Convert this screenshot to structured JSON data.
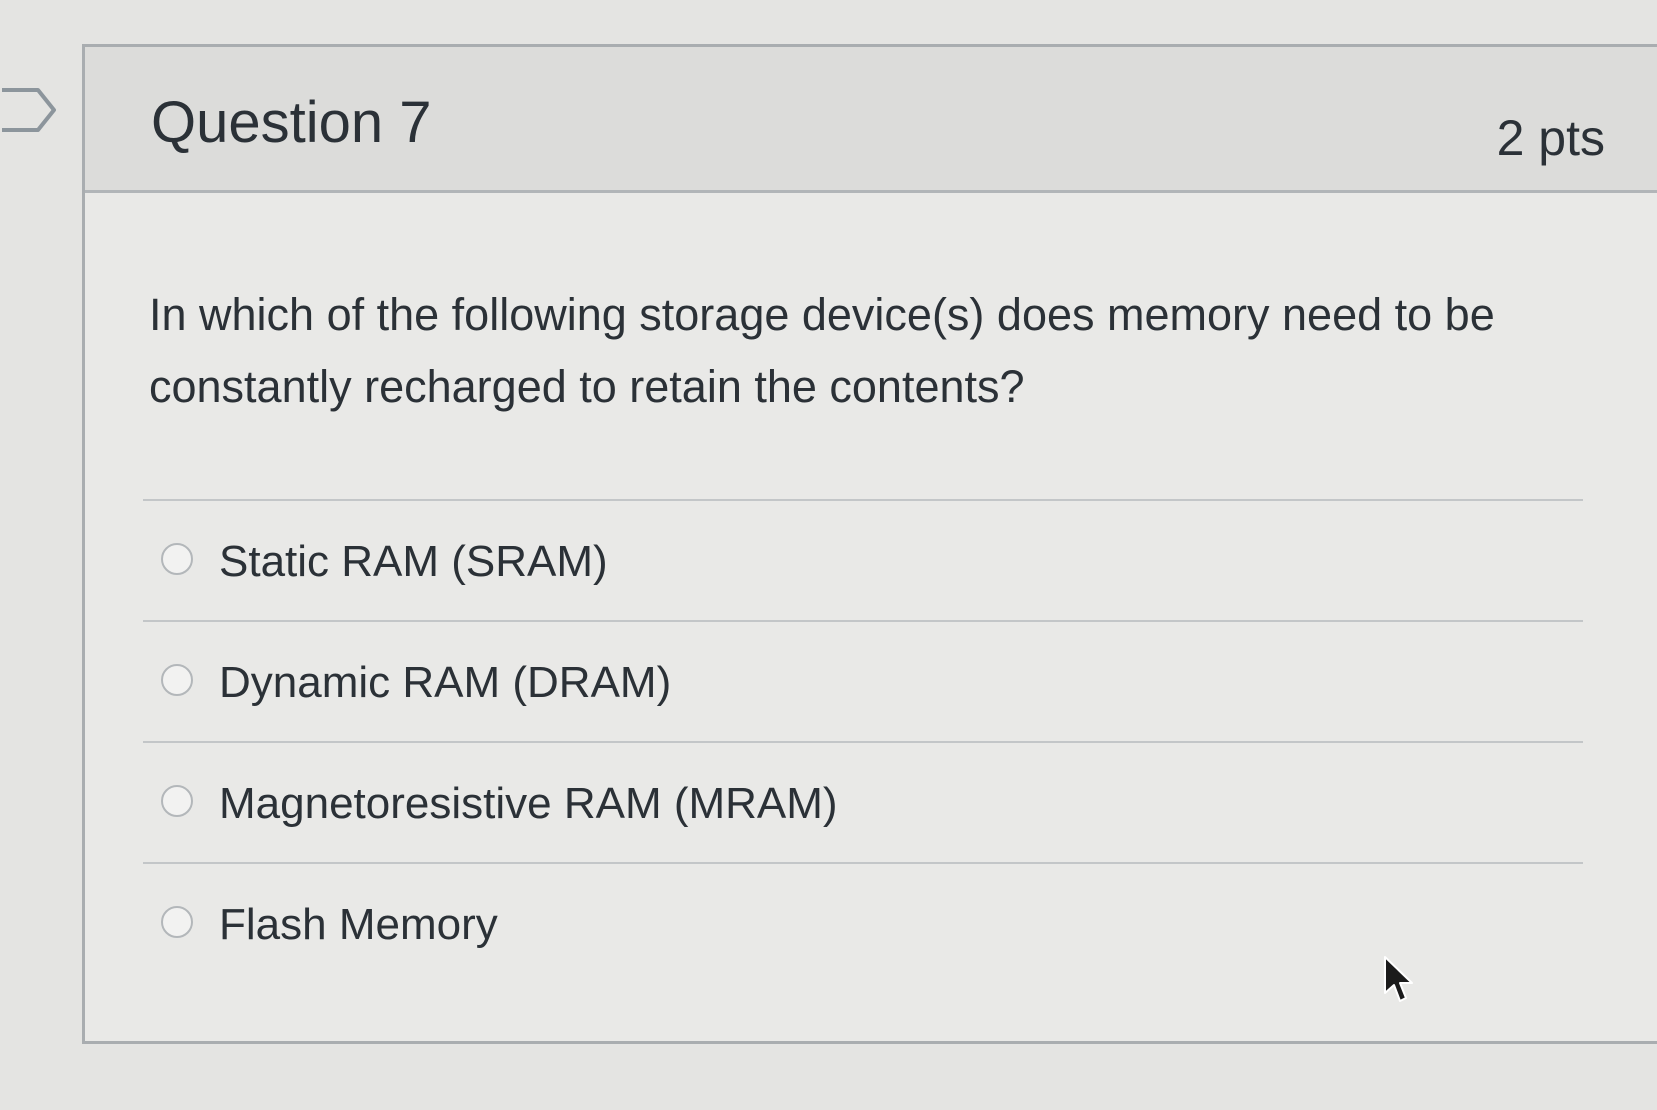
{
  "question": {
    "title": "Question 7",
    "points": "2 pts",
    "text": "In which of the following storage device(s) does memory need to be constantly recharged to retain the contents?"
  },
  "answers": [
    {
      "label": "Static RAM (SRAM)",
      "selected": false
    },
    {
      "label": "Dynamic RAM (DRAM)",
      "selected": false
    },
    {
      "label": "Magnetoresistive RAM (MRAM)",
      "selected": false
    },
    {
      "label": "Flash Memory",
      "selected": false
    }
  ],
  "icons": {
    "flag": "flag-question-icon",
    "cursor": "mouse-pointer-icon"
  },
  "colors": {
    "text": "#2b3137",
    "header_bg": "#dcdcda",
    "card_bg": "#e9e9e7",
    "border": "#a9adb0"
  }
}
